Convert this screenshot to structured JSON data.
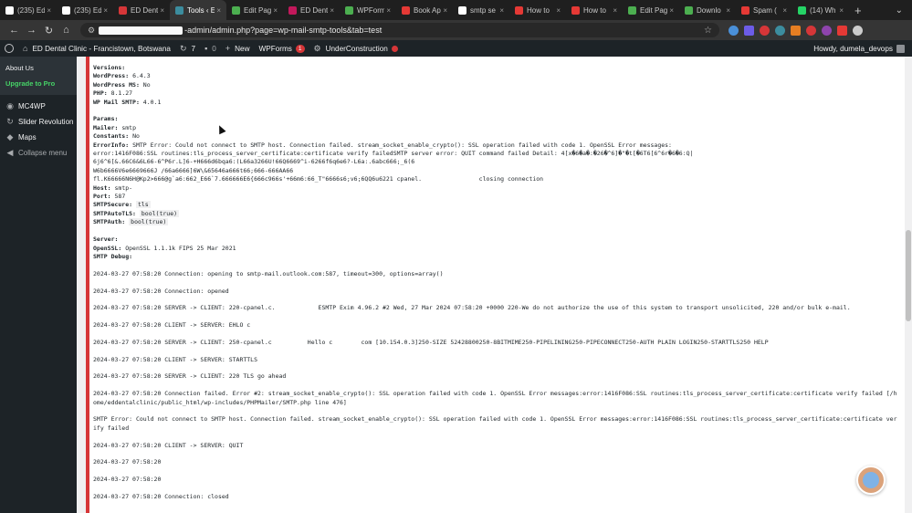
{
  "browser": {
    "tabs": [
      {
        "label": "(235) Ed",
        "color": "#ffffff"
      },
      {
        "label": "(235) Ed",
        "color": "#ffffff"
      },
      {
        "label": "ED Dent",
        "color": "#d63638"
      },
      {
        "label": "Tools ‹ E",
        "color": "#3c8d9e",
        "active": true
      },
      {
        "label": "Edit Pag",
        "color": "#4caf50"
      },
      {
        "label": "ED Dent",
        "color": "#c2185b"
      },
      {
        "label": "WPForm",
        "color": "#4caf50"
      },
      {
        "label": "Book Ap",
        "color": "#e53935"
      },
      {
        "label": "smtp se",
        "color": "#ffffff"
      },
      {
        "label": "How to",
        "color": "#e53935"
      },
      {
        "label": "How to",
        "color": "#e53935"
      },
      {
        "label": "Edit Pag",
        "color": "#4caf50"
      },
      {
        "label": "Downlo",
        "color": "#4caf50"
      },
      {
        "label": "Spam (",
        "color": "#e53935"
      },
      {
        "label": "(14) Wh",
        "color": "#25d366"
      }
    ],
    "url_suffix": "-admin/admin.php?page=wp-mail-smtp-tools&tab=test",
    "extension_colors": [
      "#4a90d9",
      "#6c5ce7",
      "#d63638",
      "#3c8d9e",
      "#e67e22",
      "#d63638",
      "#8e44ad",
      "#e53935",
      "#cccccc"
    ]
  },
  "adminbar": {
    "site_name": "ED Dental Clinic - Francistown, Botswana",
    "updates_count": "7",
    "comments_count": "0",
    "new_label": "New",
    "wpforms_label": "WPForms",
    "wpforms_badge": "1",
    "under_construction_label": "UnderConstruction",
    "howdy": "Howdy, dumela_devops"
  },
  "sidebar": {
    "about_us": "About Us",
    "upgrade": "Upgrade to Pro",
    "items": [
      {
        "label": "MC4WP",
        "icon": "mc4wp-icon"
      },
      {
        "label": "Slider Revolution",
        "icon": "slider-icon"
      },
      {
        "label": "Maps",
        "icon": "map-pin-icon"
      },
      {
        "label": "Collapse menu",
        "icon": "collapse-icon"
      }
    ]
  },
  "debug": {
    "versions_heading": "Versions:",
    "wordpress_key": "WordPress:",
    "wordpress_val": "6.4.3",
    "wordpress_ms_key": "WordPress MS:",
    "wordpress_ms_val": "No",
    "php_key": "PHP:",
    "php_val": "8.1.27",
    "wpmail_key": "WP Mail SMTP:",
    "wpmail_val": "4.0.1",
    "params_heading": "Params:",
    "mailer_key": "Mailer:",
    "mailer_val": "smtp",
    "constants_key": "Constants:",
    "constants_val": "No",
    "errorinfo_key": "ErrorInfo:",
    "errorinfo_val": "SMTP Error: Could not connect to SMTP host. Connection failed. stream_socket_enable_crypto(): SSL operation failed with code 1. OpenSSL Error messages:",
    "errorinfo_l2": "error:1416F086:SSL routines:tls_process_server_certificate:certificate verify failedSMTP server error: QUIT command failed Detail: 4[x�6�a�:�26�^6]�\"�t[�6T6[6^6r�6�6:Q|",
    "errorinfo_l3": "6j6^6[&.66C6&6L66-6^P6r.L]6-+H666d6bqa6:(L66a3266U!66Q6669^i-6266f6q6e6?-L6a:.6abc666;_6(6",
    "errorinfo_l4": "W6b6666V6e6669666J /66a6666]6W\\&65646a666t66;666-666AA66",
    "errorinfo_l5": "fl.K66666N6H@Kp2>666@g`a6:662_E66`7.666666E6{666c966s'+66m6:66_T\"6666s6;v6;6QQ6u6221 cpanel.",
    "errorinfo_l5_tail": "closing connection",
    "host_key": "Host:",
    "host_val": "smtp-",
    "port_key": "Port:",
    "port_val": "587",
    "smtpsecure_key": "SMTPSecure:",
    "smtpsecure_val": "tls",
    "smtpautotls_key": "SMTPAutoTLS:",
    "smtpautotls_val": "bool(true)",
    "smtpauth_key": "SMTPAuth:",
    "smtpauth_val": "bool(true)",
    "server_heading": "Server:",
    "openssl_key": "OpenSSL:",
    "openssl_val": "OpenSSL 1.1.1k FIPS 25 Mar 2021",
    "smtp_debug_heading": "SMTP Debug:",
    "log": [
      "2024-03-27 07:58:20 Connection: opening to smtp-mail.outlook.com:587, timeout=300, options=array()",
      "2024-03-27 07:58:20 Connection: opened",
      "2024-03-27 07:58:20 SERVER -> CLIENT: 220-cpanel.c.            ESMTP Exim 4.96.2 #2 Wed, 27 Mar 2024 07:58:20 +0000 220-We do not authorize the use of this system to transport unsolicited, 220 and/or bulk e-mail.",
      "2024-03-27 07:58:20 CLIENT -> SERVER: EHLO c",
      "2024-03-27 07:58:20 SERVER -> CLIENT: 250-cpanel.c          Hello c        com [10.154.0.3]250-SIZE 52428800250-8BITMIME250-PIPELINING250-PIPECONNECT250-AUTH PLAIN LOGIN250-STARTTLS250 HELP",
      "2024-03-27 07:58:20 CLIENT -> SERVER: STARTTLS",
      "2024-03-27 07:58:20 SERVER -> CLIENT: 220 TLS go ahead",
      "2024-03-27 07:58:20 Connection failed. Error #2: stream_socket_enable_crypto(): SSL operation failed with code 1. OpenSSL Error messages:error:1416F086:SSL routines:tls_process_server_certificate:certificate verify failed [/home/eddentalclinic/public_html/wp-includes/PHPMailer/SMTP.php line 476]",
      "SMTP Error: Could not connect to SMTP host. Connection failed. stream_socket_enable_crypto(): SSL operation failed with code 1. OpenSSL Error messages:error:1416F086:SSL routines:tls_process_server_certificate:certificate verify failed",
      "2024-03-27 07:58:20 CLIENT -> SERVER: QUIT",
      "2024-03-27 07:58:20",
      "2024-03-27 07:58:20",
      "2024-03-27 07:58:20 Connection: closed"
    ]
  }
}
